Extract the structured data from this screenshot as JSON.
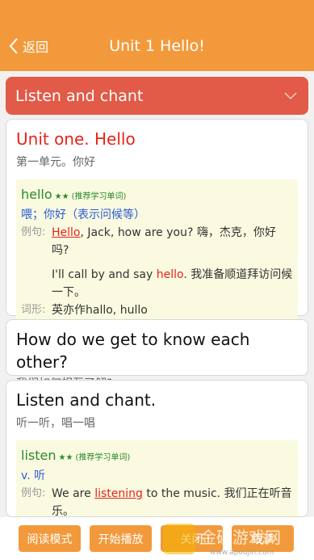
{
  "header": {
    "back_label": "返回",
    "title": "Unit 1 Hello!"
  },
  "section": {
    "title": "Listen and chant"
  },
  "cards": [
    {
      "en": "Unit one. Hello",
      "zh": "第一单元。你好",
      "dict": {
        "word": "hello",
        "stars": "★★",
        "tag": "(推荐学习单词)",
        "meaning": "喂；你好（表示问候等）",
        "example_label": "例句:",
        "example1_word": "Hello",
        "example1_rest": ", Jack, how are you? 嗨，杰克，你好吗?",
        "example2_pre": "I'll call by and say ",
        "example2_word": "hello",
        "example2_rest": ". 我准备顺道拜访问候一下。",
        "forms_label": "词形:",
        "forms": "英亦作hallo, hullo"
      }
    },
    {
      "en": "How do we get to know each other?",
      "zh": "我们如何相互了解?"
    },
    {
      "en": "Listen and chant.",
      "zh": "听一听，唱一唱",
      "dict": {
        "word": "listen",
        "stars": "★★",
        "tag": "(推荐学习单词)",
        "meaning": "v. 听",
        "example_label": "例句:",
        "example1_pre": "We are ",
        "example1_word": "listening",
        "example1_rest": " to the music. 我们正在听音乐。"
      }
    }
  ],
  "bottom": {
    "read_mode": "阅读模式",
    "start_play": "开始播放",
    "btn3": "关闭",
    "btn4": "跟读"
  },
  "watermark": "金碟游戏网 www.apoujin.com",
  "colors": {
    "header": "#f29a3b",
    "section": "#e25a48",
    "highlight": "#e5231b",
    "word_green": "#2a8a2a",
    "meaning_blue": "#2a5bd7"
  }
}
